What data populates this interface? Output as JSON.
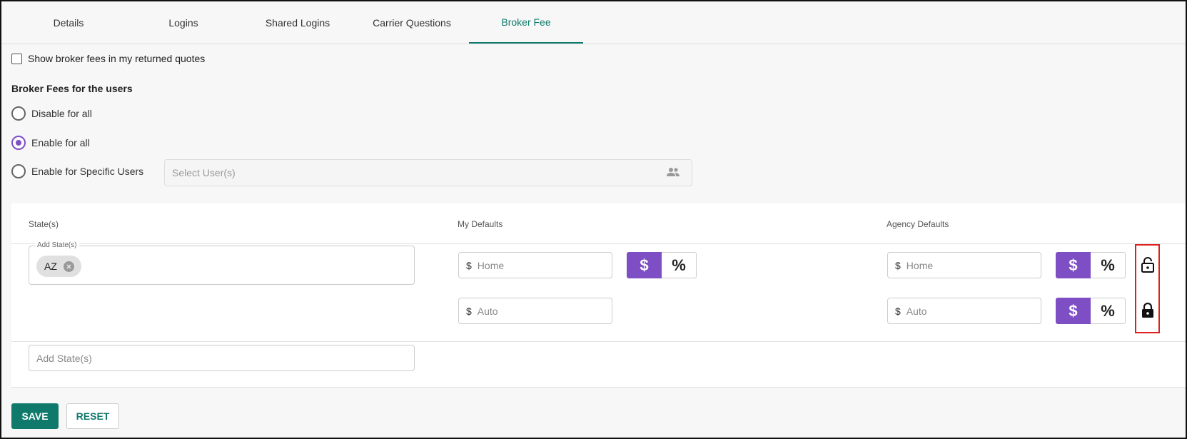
{
  "tabs": [
    {
      "label": "Details"
    },
    {
      "label": "Logins"
    },
    {
      "label": "Shared Logins"
    },
    {
      "label": "Carrier Questions"
    },
    {
      "label": "Broker Fee",
      "active": true
    }
  ],
  "show_fees_checkbox": {
    "label": "Show broker fees in my returned quotes",
    "checked": false
  },
  "broker_fees_section": {
    "title": "Broker Fees for the users",
    "options": [
      {
        "label": "Disable for all",
        "selected": false
      },
      {
        "label": "Enable for all",
        "selected": true
      },
      {
        "label": "Enable for Specific Users",
        "selected": false
      }
    ],
    "user_select_placeholder": "Select User(s)"
  },
  "table": {
    "headers": {
      "states": "State(s)",
      "my_defaults": "My Defaults",
      "agency_defaults": "Agency Defaults"
    },
    "row": {
      "states_legend": "Add State(s)",
      "states": [
        "AZ"
      ],
      "my_defaults": [
        {
          "currency": "$",
          "placeholder": "Home",
          "mode": "dollar"
        },
        {
          "currency": "$",
          "placeholder": "Auto"
        }
      ],
      "agency_defaults": [
        {
          "currency": "$",
          "placeholder": "Home",
          "mode": "dollar",
          "locked": false
        },
        {
          "currency": "$",
          "placeholder": "Auto",
          "mode": "dollar",
          "locked": true
        }
      ],
      "toggle_labels": {
        "dollar": "$",
        "percent": "%"
      }
    },
    "add_state_placeholder": "Add State(s)"
  },
  "actions": {
    "save_label": "SAVE",
    "reset_label": "RESET"
  },
  "colors": {
    "accent_teal": "#0f7a6c",
    "toggle_purple": "#7e4fc4",
    "highlight_red": "#e02020"
  }
}
